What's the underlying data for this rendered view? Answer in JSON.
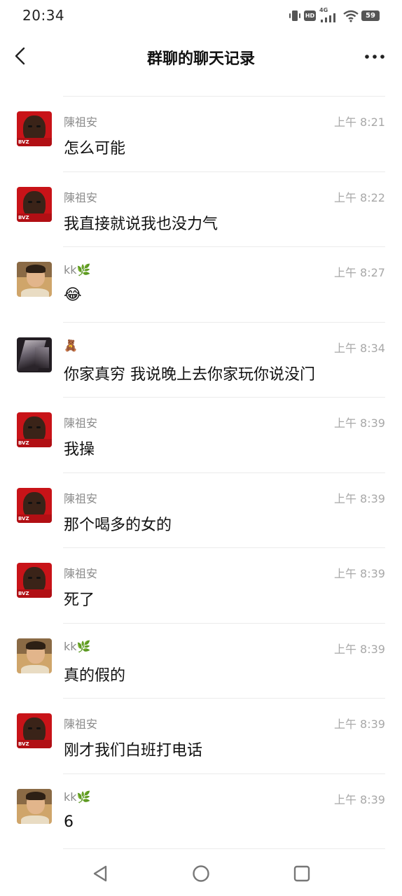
{
  "status_bar": {
    "time": "20:34",
    "hd_badge": "HD",
    "network": "4G",
    "battery": "59",
    "icons": [
      "vibrate-icon",
      "hd-icon",
      "signal-4g-icon",
      "wifi-icon",
      "battery-icon"
    ]
  },
  "header": {
    "title": "群聊的聊天记录",
    "back_icon": "chevron-left-icon",
    "more_icon": "more-dots-icon"
  },
  "messages": [
    {
      "sender": "陳祖安",
      "time": "上午 8:21",
      "text": "怎么可能",
      "avatar": "red"
    },
    {
      "sender": "陳祖安",
      "time": "上午 8:22",
      "text": "我直接就说我也没力气",
      "avatar": "red"
    },
    {
      "sender": "kk🌿",
      "time": "上午 8:27",
      "text": "😂",
      "avatar": "kk"
    },
    {
      "sender": "🧸",
      "time": "上午 8:34",
      "text": "你家真穷 我说晚上去你家玩你说没门",
      "avatar": "dark"
    },
    {
      "sender": "陳祖安",
      "time": "上午 8:39",
      "text": "我操",
      "avatar": "red"
    },
    {
      "sender": "陳祖安",
      "time": "上午 8:39",
      "text": "那个喝多的女的",
      "avatar": "red"
    },
    {
      "sender": "陳祖安",
      "time": "上午 8:39",
      "text": "死了",
      "avatar": "red"
    },
    {
      "sender": "kk🌿",
      "time": "上午 8:39",
      "text": "真的假的",
      "avatar": "kk"
    },
    {
      "sender": "陳祖安",
      "time": "上午 8:39",
      "text": "刚才我们白班打电话",
      "avatar": "red"
    },
    {
      "sender": "kk🌿",
      "time": "上午 8:39",
      "text": "6",
      "avatar": "kk"
    }
  ],
  "nav_bar": {
    "icons": [
      "nav-back-icon",
      "nav-home-icon",
      "nav-recents-icon"
    ]
  },
  "colors": {
    "background": "#ffffff",
    "divider": "#ebebeb",
    "sender_text": "#8b8b8b",
    "time_text": "#a8a8a8",
    "message_text": "#111111"
  }
}
